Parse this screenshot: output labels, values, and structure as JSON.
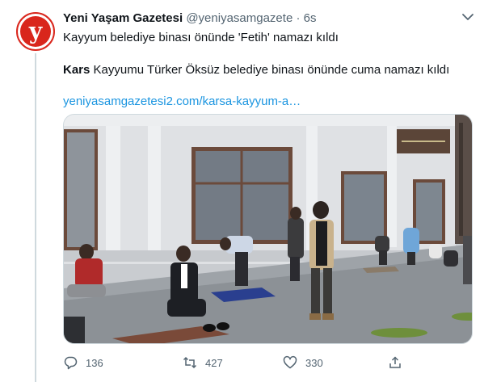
{
  "tweet": {
    "author_name": "Yeni Yaşam Gazetesi",
    "handle": "@yeniyasamgazete",
    "separator": "·",
    "time": "6s",
    "avatar_letter": "y",
    "text_line1": "Kayyum belediye binası önünde 'Fetih' namazı kıldı",
    "text_bold": "Kars",
    "text_line2_rest": " Kayyumu Türker Öksüz belediye binası önünde cuma namazı kıldı",
    "link": "yeniyasamgazetesi2.com/karsa-kayyum-a…",
    "photo_alt_icon": "photo",
    "actions": {
      "reply_count": "136",
      "retweet_count": "427",
      "like_count": "330"
    }
  },
  "colors": {
    "brand_red": "#d9261c",
    "link_blue": "#1b95e0",
    "muted": "#536471"
  },
  "icons": {
    "more": "chevron-down-icon",
    "reply": "reply-icon",
    "retweet": "retweet-icon",
    "like": "heart-icon",
    "share": "share-icon"
  }
}
